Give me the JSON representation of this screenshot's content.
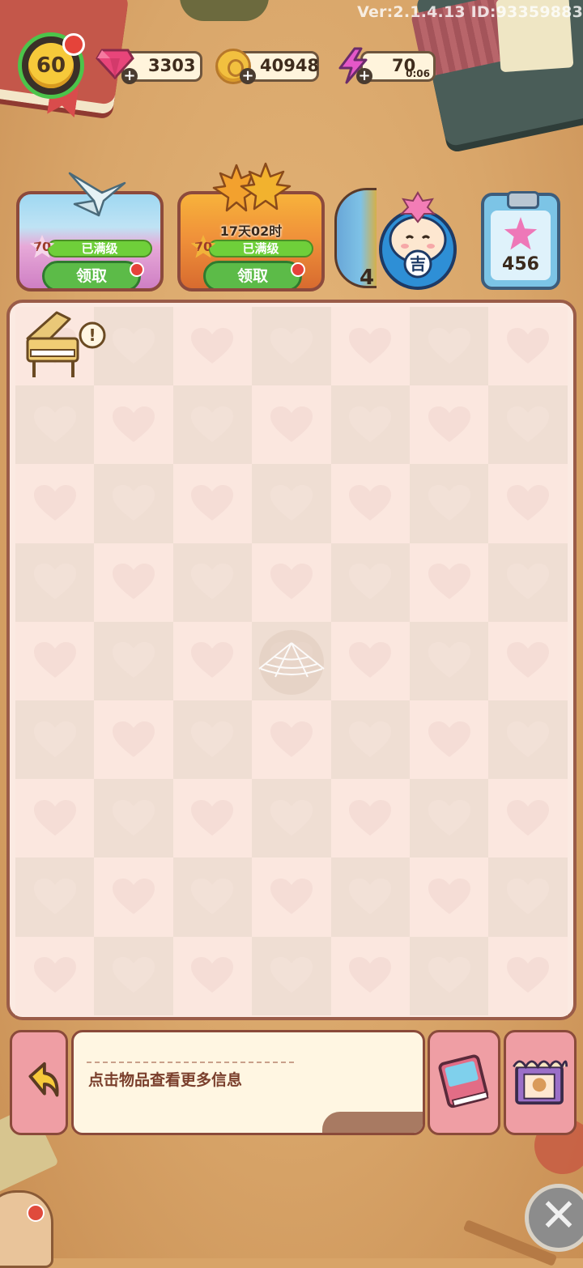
{
  "version_text": "Ver:2.1.4.13 ID:93359883",
  "player": {
    "level": "60"
  },
  "resources": {
    "gems": "3303",
    "coins": "40948",
    "energy": "70",
    "energy_timer": "0:06",
    "plus_symbol": "+"
  },
  "events": [
    {
      "name": "paper-crane-event",
      "level": "70",
      "status": "已满级",
      "claim_label": "领取"
    },
    {
      "name": "maple-leaf-event",
      "timer": "17天02时",
      "level": "70",
      "status": "已满级",
      "claim_label": "领取"
    }
  ],
  "globe_event": {
    "count_partial": "4"
  },
  "daruma": {
    "glyph": "吉"
  },
  "task_board": {
    "count": "456"
  },
  "board": {
    "rows": 9,
    "cols": 7
  },
  "info_panel": {
    "hint": "点击物品查看更多信息"
  },
  "close_symbol": "✕",
  "colors": {
    "background": "#d9a66a",
    "board_light": "#fbe7df",
    "board_dark": "#efded3",
    "claim_green": "#5cbb48",
    "pink_button": "#ef9ea4"
  },
  "icons": [
    "gem-icon",
    "coin-icon",
    "energy-icon",
    "paper-crane-icon",
    "maple-leaf-icon",
    "globe-icon",
    "daruma-icon",
    "clipboard-icon",
    "piano-icon",
    "cobweb-icon",
    "back-arrow-icon",
    "book-icon",
    "shop-icon",
    "close-icon",
    "heart-icon"
  ]
}
